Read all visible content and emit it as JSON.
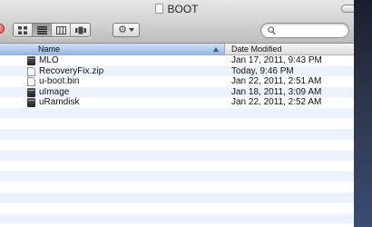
{
  "window": {
    "title": "BOOT"
  },
  "toolbar": {
    "view_buttons": [
      "icon-view",
      "list-view",
      "column-view",
      "cover-flow-view"
    ],
    "active_view": "list-view",
    "action_icon": "gear-icon",
    "search_placeholder": ""
  },
  "columns": {
    "name": "Name",
    "date_modified": "Date Modified"
  },
  "files": [
    {
      "name": "MLO",
      "date": "Jan 17, 2011, 9:43 PM",
      "icon": "executable-icon"
    },
    {
      "name": "RecoveryFix.zip",
      "date": "Today, 9:46 PM",
      "icon": "zip-document-icon"
    },
    {
      "name": "u-boot.bin",
      "date": "Jan 22, 2011, 2:51 AM",
      "icon": "document-icon"
    },
    {
      "name": "uImage",
      "date": "Jan 18, 2011, 3:09 AM",
      "icon": "executable-icon"
    },
    {
      "name": "uRamdisk",
      "date": "Jan 22, 2011, 2:52 AM",
      "icon": "executable-icon"
    }
  ],
  "colors": {
    "header_selected": "#8fb4e0",
    "row_stripe": "#edf3fe",
    "close_button": "#e0443a"
  }
}
